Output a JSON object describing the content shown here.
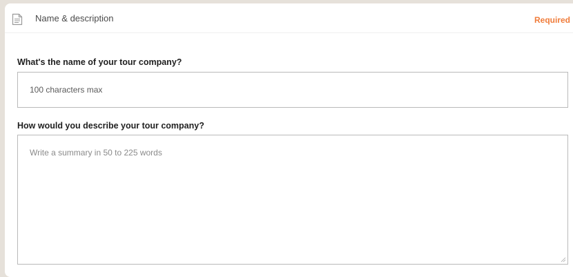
{
  "header": {
    "title": "Name & description",
    "badge": "Required",
    "icon": "document-icon"
  },
  "fields": {
    "name": {
      "label": "What's the name of your tour company?",
      "placeholder": "100 characters max",
      "value": ""
    },
    "description": {
      "label": "How would you describe your tour company?",
      "placeholder": "Write a summary in 50 to 225 words",
      "value": ""
    }
  },
  "colors": {
    "page_background": "#e6e1da",
    "card_background": "#ffffff",
    "required_accent": "#f07c3a",
    "input_border": "#b9b9b9"
  }
}
